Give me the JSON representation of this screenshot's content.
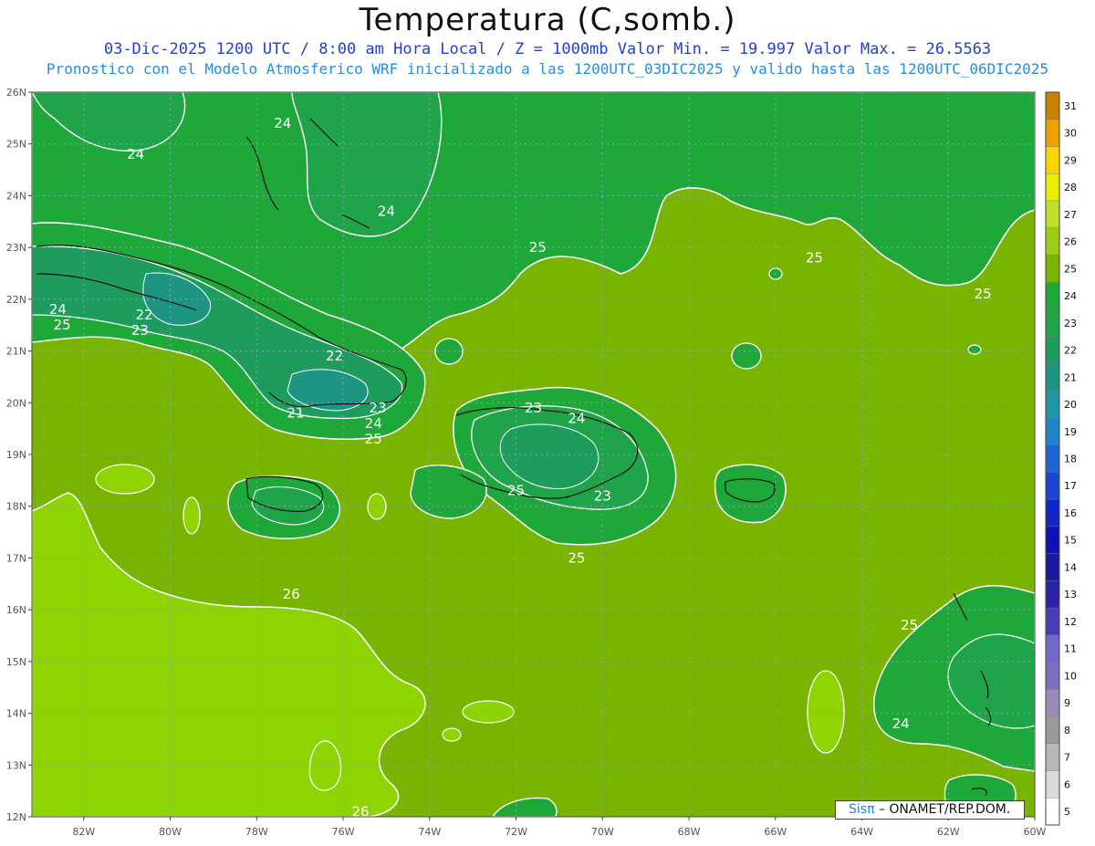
{
  "header": {
    "title": "Temperatura (C,somb.)",
    "line1": "03-Dic-2025  1200 UTC / 8:00 am Hora Local / Z = 1000mb    Valor Min. = 19.997  Valor Max. = 26.5563",
    "line2": "Pronostico con el Modelo Atmosferico WRF inicializado a las 1200UTC_03DIC2025 y valido hasta las  1200UTC_06DIC2025"
  },
  "map": {
    "lon_range": [
      -83.2,
      -60
    ],
    "lat_range": [
      12,
      26
    ],
    "lat_ticks": [
      "12N",
      "13N",
      "14N",
      "15N",
      "16N",
      "17N",
      "18N",
      "19N",
      "20N",
      "21N",
      "22N",
      "23N",
      "24N",
      "25N",
      "26N"
    ],
    "lon_ticks": [
      "82W",
      "80W",
      "78W",
      "76W",
      "74W",
      "72W",
      "70W",
      "68W",
      "66W",
      "64W",
      "62W",
      "60W"
    ],
    "contour_labels": [
      {
        "text": "24",
        "lon": -80.8,
        "lat": 24.8
      },
      {
        "text": "24",
        "lon": -77.4,
        "lat": 25.4
      },
      {
        "text": "24",
        "lon": -75.0,
        "lat": 23.7
      },
      {
        "text": "25",
        "lon": -71.5,
        "lat": 23.0
      },
      {
        "text": "25",
        "lon": -65.1,
        "lat": 22.8
      },
      {
        "text": "25",
        "lon": -61.2,
        "lat": 22.1
      },
      {
        "text": "24",
        "lon": -82.6,
        "lat": 21.8
      },
      {
        "text": "25",
        "lon": -82.5,
        "lat": 21.5
      },
      {
        "text": "22",
        "lon": -80.6,
        "lat": 21.7
      },
      {
        "text": "23",
        "lon": -80.7,
        "lat": 21.4
      },
      {
        "text": "22",
        "lon": -76.2,
        "lat": 20.9
      },
      {
        "text": "23",
        "lon": -75.2,
        "lat": 19.9
      },
      {
        "text": "21",
        "lon": -77.1,
        "lat": 19.8
      },
      {
        "text": "24",
        "lon": -75.3,
        "lat": 19.6
      },
      {
        "text": "25",
        "lon": -75.3,
        "lat": 19.3
      },
      {
        "text": "23",
        "lon": -71.6,
        "lat": 19.9
      },
      {
        "text": "24",
        "lon": -70.6,
        "lat": 19.7
      },
      {
        "text": "25",
        "lon": -72.0,
        "lat": 18.3
      },
      {
        "text": "23",
        "lon": -70.0,
        "lat": 18.2
      },
      {
        "text": "25",
        "lon": -70.6,
        "lat": 17.0
      },
      {
        "text": "26",
        "lon": -77.2,
        "lat": 16.3
      },
      {
        "text": "25",
        "lon": -62.9,
        "lat": 15.7
      },
      {
        "text": "24",
        "lon": -63.1,
        "lat": 13.8
      },
      {
        "text": "26",
        "lon": -75.6,
        "lat": 12.1
      }
    ]
  },
  "colorbar": {
    "labels": [
      "5",
      "6",
      "7",
      "8",
      "9",
      "10",
      "11",
      "12",
      "13",
      "14",
      "15",
      "16",
      "17",
      "18",
      "19",
      "20",
      "21",
      "22",
      "23",
      "24",
      "25",
      "26",
      "27",
      "28",
      "29",
      "30",
      "31"
    ],
    "colors": [
      "#ffffff",
      "#dadada",
      "#b8b8b8",
      "#9a9a9a",
      "#9a8ab8",
      "#7f6fc0",
      "#6f69c8",
      "#4a3bb6",
      "#2a22a8",
      "#1a1aa0",
      "#1010b8",
      "#1226c8",
      "#1a46d0",
      "#1f66d4",
      "#1f84c8",
      "#1f98a6",
      "#1c9682",
      "#1e9c5e",
      "#20a44a",
      "#1ea83a",
      "#78b400",
      "#9ccc14",
      "#bfe02c",
      "#e6f000",
      "#ffd400",
      "#f0a000",
      "#c88200"
    ]
  },
  "credit": {
    "brand": "Sisπ",
    "text": "– ONAMET/REP.DOM."
  }
}
